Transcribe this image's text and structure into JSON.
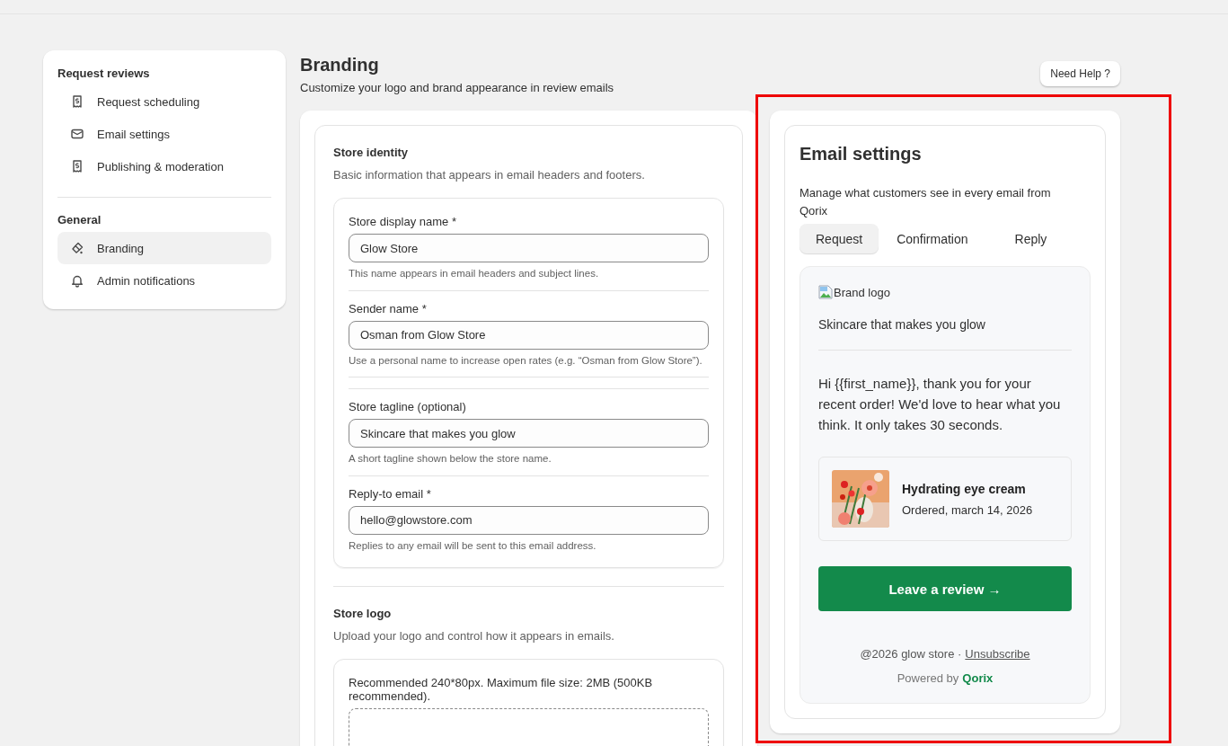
{
  "sidebar": {
    "groups": [
      {
        "title": "Request reviews",
        "items": [
          {
            "label": "Request scheduling",
            "selected": false
          },
          {
            "label": "Email settings",
            "selected": false
          },
          {
            "label": "Publishing & moderation",
            "selected": false
          }
        ]
      },
      {
        "title": "General",
        "items": [
          {
            "label": "Branding",
            "selected": true
          },
          {
            "label": "Admin notifications",
            "selected": false
          }
        ]
      }
    ]
  },
  "page": {
    "title": "Branding",
    "subtitle": "Customize your logo and brand appearance in review emails",
    "help_button": "Need Help ?"
  },
  "sections": [
    {
      "title": "Store identity",
      "description": "Basic information that appears in email headers and footers.",
      "fields": [
        {
          "label": "Store display name *",
          "value": "Glow Store",
          "help": "This name appears in email headers and subject lines."
        },
        {
          "label": "Sender name *",
          "value": "Osman from Glow Store",
          "help": "Use a personal name to increase open rates (e.g. “Osman from Glow Store”)."
        },
        {
          "label": "Store tagline (optional)",
          "value": "Skincare that makes you glow",
          "help": "A short tagline shown below the store name."
        },
        {
          "label": "Reply-to email *",
          "value": "hello@glowstore.com",
          "help": "Replies to any email will be sent to this email address."
        }
      ]
    },
    {
      "title": "Store logo",
      "description": "Upload your logo and control how it appears in emails.",
      "note": "Recommended 240*80px. Maximum file size: 2MB (500KB recommended)."
    }
  ],
  "preview": {
    "title": "Email settings",
    "description": "Manage what customers see in every email from Qorix",
    "tabs": [
      {
        "label": "Request",
        "selected": true
      },
      {
        "label": "Confirmation",
        "selected": false
      },
      {
        "label": "Reply",
        "selected": false
      }
    ],
    "email": {
      "logo_alt": "Brand logo",
      "tagline": "Skincare that makes you glow",
      "message": "Hi {{first_name}}, thank you for your recent order! We'd love to hear what you think. It only takes 30 seconds.",
      "product": {
        "name": "Hydrating eye cream",
        "ordered": "Ordered, march 14, 2026"
      },
      "cta": "Leave a review →",
      "copyright": "@2026 glow store ·",
      "unsubscribe": "Unsubscribe",
      "powered_by": "Powered by",
      "brand": "Qorix"
    }
  }
}
